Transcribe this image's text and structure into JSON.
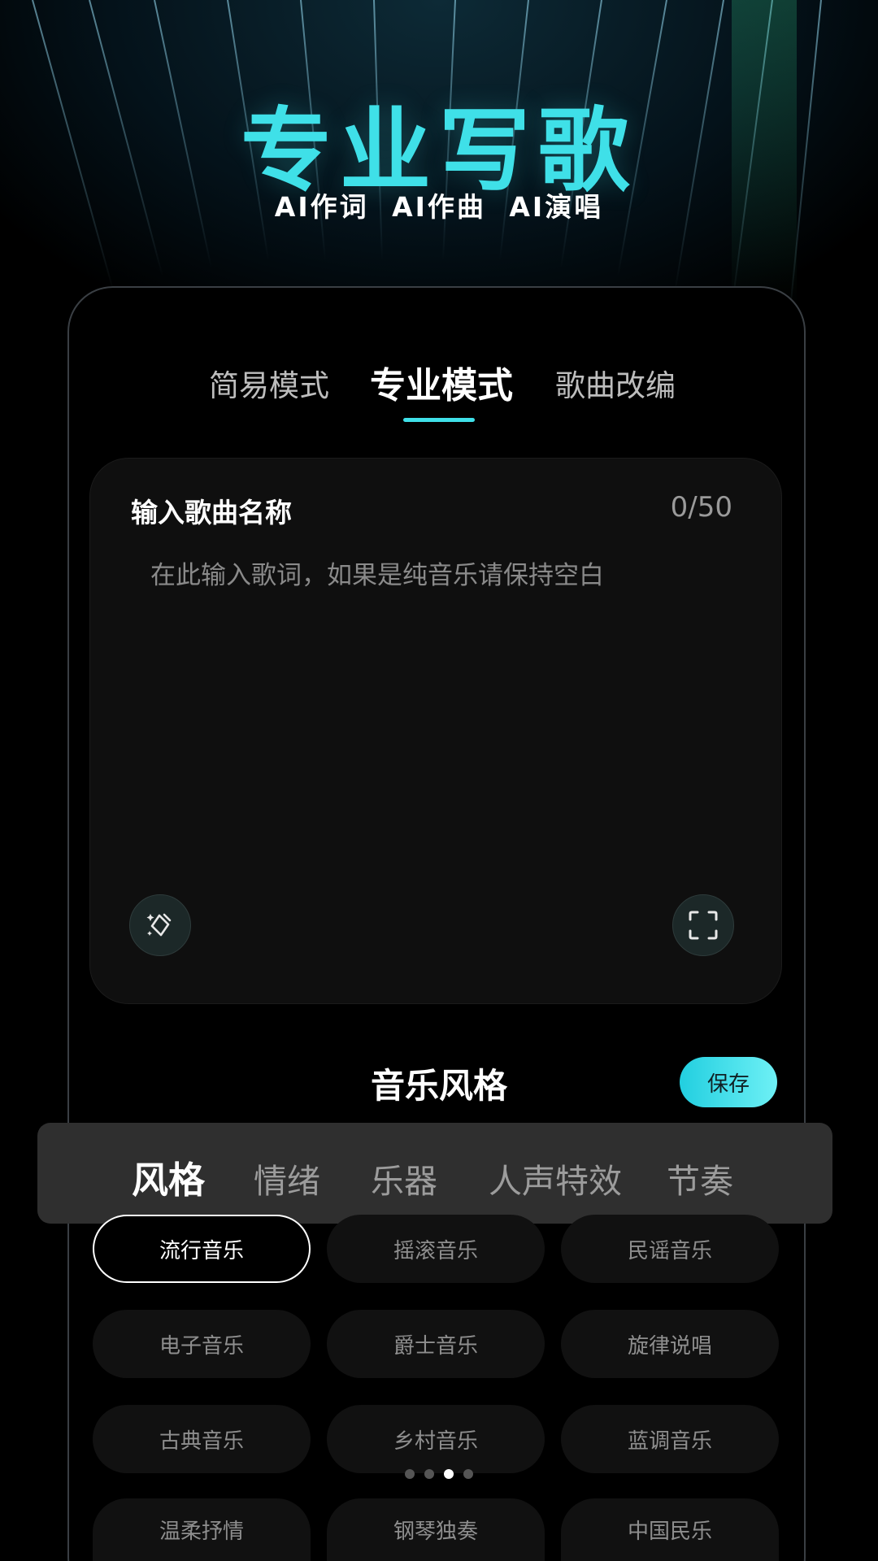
{
  "hero": {
    "title": "专业写歌",
    "subtitle": "AI作词 AI作曲 AI演唱"
  },
  "mode_tabs": [
    {
      "label": "简易模式",
      "active": false
    },
    {
      "label": "专业模式",
      "active": true
    },
    {
      "label": "歌曲改编",
      "active": false
    }
  ],
  "editor": {
    "song_name_placeholder": "输入歌曲名称",
    "counter": "0/50",
    "lyrics_placeholder": "在此输入歌词，如果是纯音乐请保持空白",
    "left_icon": "magic-wand-icon",
    "right_icon": "scan-icon"
  },
  "music_style": {
    "title": "音乐风格",
    "save_label": "保存"
  },
  "categories": [
    {
      "label": "风格",
      "active": true
    },
    {
      "label": "情绪",
      "active": false
    },
    {
      "label": "乐器",
      "active": false
    },
    {
      "label": "人声特效",
      "active": false
    },
    {
      "label": "节奏",
      "active": false
    }
  ],
  "styles": [
    {
      "label": "流行音乐",
      "selected": true
    },
    {
      "label": "摇滚音乐",
      "selected": false
    },
    {
      "label": "民谣音乐",
      "selected": false
    },
    {
      "label": "电子音乐",
      "selected": false
    },
    {
      "label": "爵士音乐",
      "selected": false
    },
    {
      "label": "旋律说唱",
      "selected": false
    },
    {
      "label": "古典音乐",
      "selected": false
    },
    {
      "label": "乡村音乐",
      "selected": false
    },
    {
      "label": "蓝调音乐",
      "selected": false
    },
    {
      "label": "温柔抒情",
      "selected": false
    },
    {
      "label": "钢琴独奏",
      "selected": false
    },
    {
      "label": "中国民乐",
      "selected": false
    }
  ],
  "pager": {
    "count": 4,
    "active_index": 2
  },
  "colors": {
    "accent": "#3fe0e8",
    "background": "#000000",
    "card": "#0f0f0f"
  }
}
